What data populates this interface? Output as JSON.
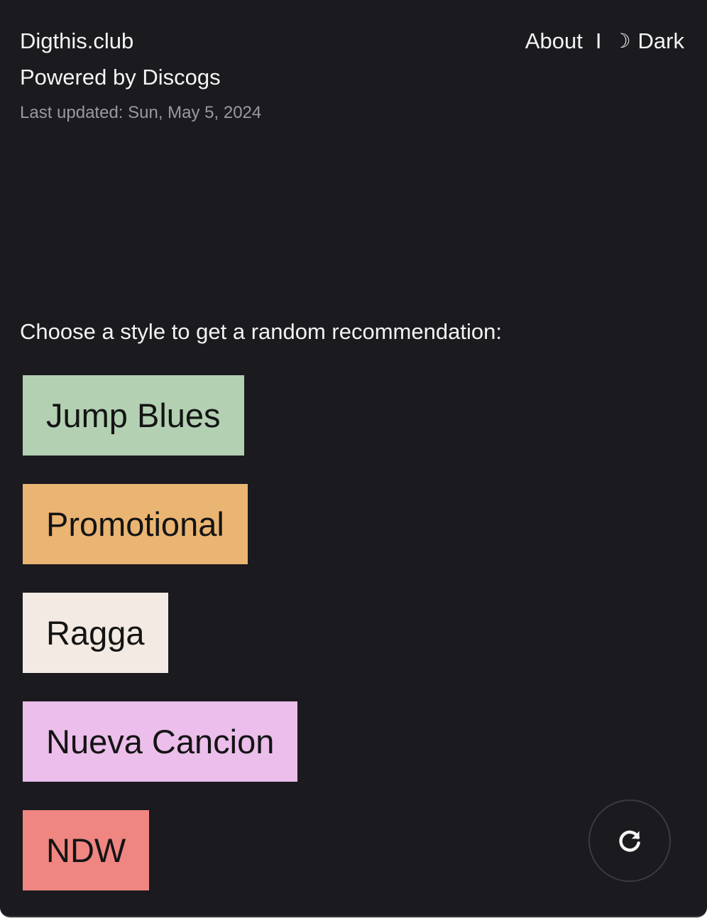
{
  "header": {
    "site_name": "Digthis.club",
    "powered_by": "Powered by Discogs",
    "last_updated": "Last updated: Sun, May 5, 2024"
  },
  "nav": {
    "about_label": "About",
    "separator": "I",
    "theme_icon": "☽",
    "theme_label": "Dark"
  },
  "main": {
    "prompt": "Choose a style to get a random recommendation:",
    "styles": [
      {
        "label": "Jump Blues",
        "color": "#b3d0b2"
      },
      {
        "label": "Promotional",
        "color": "#eab572"
      },
      {
        "label": "Ragga",
        "color": "#f3ebe3"
      },
      {
        "label": "Nueva Cancion",
        "color": "#ecbeeb"
      },
      {
        "label": "NDW",
        "color": "#ef8681"
      }
    ]
  },
  "refresh_button": {
    "icon": "refresh-icon"
  },
  "colors": {
    "background": "#1b1a1f",
    "text": "#f4f4f4",
    "muted_text": "#9a999e"
  }
}
